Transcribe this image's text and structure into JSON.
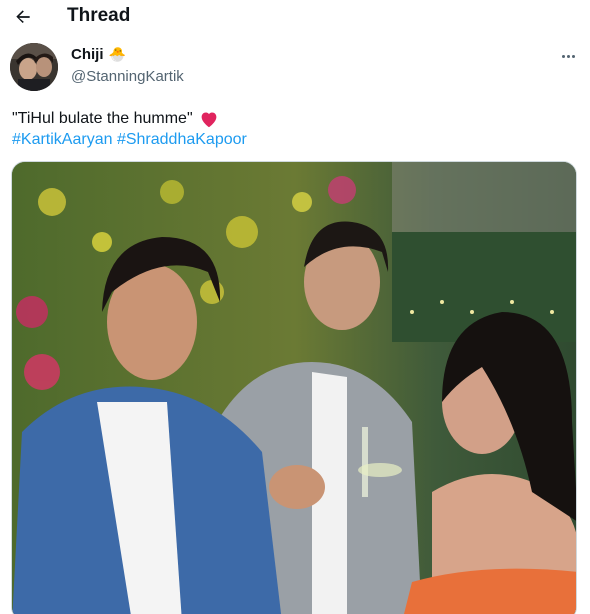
{
  "header": {
    "back_icon": "arrow-left-icon",
    "title": "Thread"
  },
  "tweet": {
    "author": {
      "display_name": "Chiji",
      "emoji": "🐣",
      "handle": "@StanningKartik",
      "avatar_icon": "avatar"
    },
    "text": "\"TiHul bulate the humme\"",
    "heart_emoji": "heart-icon",
    "hashtags": [
      "#KartikAaryan",
      "#ShraddhaKapoor"
    ],
    "more_icon": "more-horizontal-icon",
    "media_type": "video-still"
  },
  "colors": {
    "link": "#1d9bf0",
    "secondary_text": "#536471",
    "heart": "#e0245e",
    "dress": "#e8703a",
    "blazer": "#3d6aa8",
    "gray_blazer": "#9aa0a6"
  }
}
